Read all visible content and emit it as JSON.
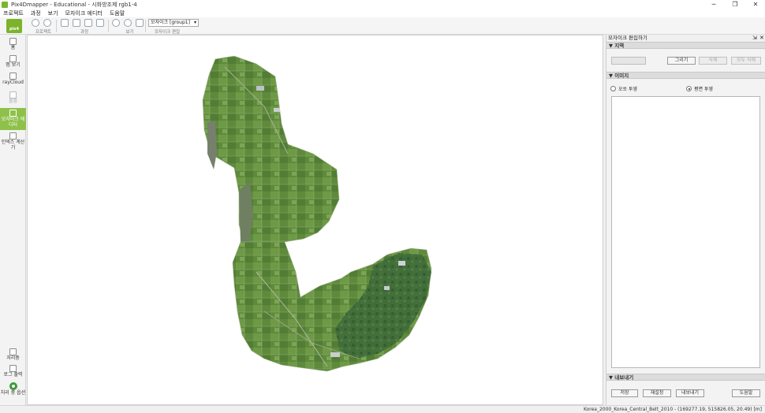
{
  "window": {
    "title": "Pix4Dmapper - Educational - 시화방조제 rgb1-4",
    "minimize": "─",
    "maximize": "❐",
    "close": "✕"
  },
  "menu": [
    "프로젝트",
    "과정",
    "보기",
    "모자이크 에디터",
    "도움말"
  ],
  "toolbar": {
    "logo_text": "pix4",
    "groups": {
      "project": "프로젝트",
      "process": "과정",
      "view": "보기",
      "mosaic_edit": "모자이크 편집"
    },
    "mosaic_select": "모자이크 [group1]"
  },
  "sidebar": {
    "items": [
      {
        "label": "홈"
      },
      {
        "label": "맵 보기"
      },
      {
        "label": "rayCloud"
      },
      {
        "label": "볼륨"
      },
      {
        "label": "모자이크 에디터"
      },
      {
        "label": "인덱스 계산기"
      }
    ],
    "bottom": [
      {
        "label": "처리중"
      },
      {
        "label": "로그 출력"
      },
      {
        "label": "처리 중 옵션"
      }
    ]
  },
  "panel": {
    "title": "모자이크 편집하기",
    "pin": "⇲",
    "close": "✕",
    "region": {
      "header": "▼ 지역",
      "draw": "그리기",
      "delete": "삭제",
      "delete_all": "모두 삭제"
    },
    "images": {
      "header": "▼ 이미지",
      "ortho": "오쏘 투영",
      "planar": "평면 투영"
    },
    "export": {
      "header": "▼ 내보내기",
      "save": "저장",
      "reset": "재설정",
      "export": "내보내기",
      "help": "도움말"
    }
  },
  "status": {
    "coords": "Korea_2000_Korea_Central_Belt_2010 - (169277.19, 515826.05, 20.49) [m]"
  },
  "colors": {
    "brand_green": "#7cb32c",
    "active_tab": "#8fc14a",
    "mosaic_green": "#5f8a3c"
  }
}
